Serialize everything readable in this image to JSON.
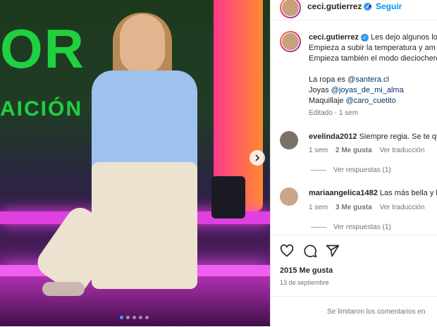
{
  "header": {
    "username": "ceci.gutierrez",
    "separator": "•",
    "follow_label": "Seguir"
  },
  "caption": {
    "username": "ceci.gutierrez",
    "line1": "Les dejo algunos lo",
    "line2": "Empieza a subir la temperatura y am",
    "line3": "Empieza también el modo dieciochero",
    "clothes_prefix": "La ropa es ",
    "clothes_link": "@santera.cl",
    "jewelry_prefix": "Joyas ",
    "jewelry_link": "@joyas_de_mi_alma",
    "makeup_prefix": "Maquillaje ",
    "makeup_link": "@caro_cuetito",
    "edited": "Editado",
    "dot": "·",
    "time": "1 sem"
  },
  "comments": [
    {
      "username": "evelinda2012",
      "text": "Siempre regia. Se te qu",
      "time": "1 sem",
      "likes": "2 Me gusta",
      "translate": "Ver traducción",
      "replies": "Ver respuestas (1)"
    },
    {
      "username": "mariaangelica1482",
      "text": "Las más bella y la",
      "time": "1 sem",
      "likes": "3 Me gusta",
      "translate": "Ver traducción",
      "replies": "Ver respuestas (1)"
    }
  ],
  "post": {
    "likes": "2015 Me gusta",
    "date": "13 de septiembre",
    "comments_limited": "Se limitaron los comentarios en"
  },
  "media": {
    "wall_big": "OR",
    "wall_small": "AICIÓN",
    "carousel_count": 5,
    "carousel_active": 0
  },
  "colors": {
    "link": "#00376b",
    "follow": "#0095f6",
    "verified": "#3897f0"
  }
}
